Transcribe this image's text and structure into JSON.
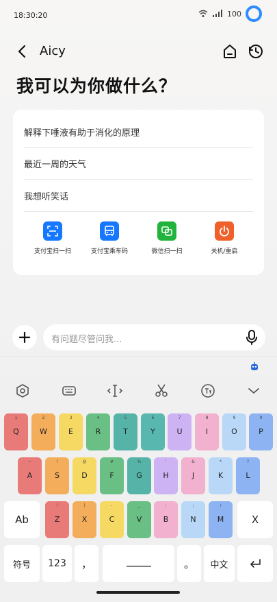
{
  "status": {
    "time": "18:30:20",
    "battery": "100"
  },
  "header": {
    "title": "Aicy"
  },
  "headline": "我可以为你做什么？",
  "suggestions": [
    "解释下唾液有助于消化的原理",
    "最近一周的天气",
    "我想听笑话"
  ],
  "shortcuts": [
    {
      "label": "支付宝扫一扫",
      "color": "#1677ff"
    },
    {
      "label": "支付宝乘车码",
      "color": "#1677ff"
    },
    {
      "label": "微信扫一扫",
      "color": "#21b33b"
    },
    {
      "label": "关机/重启",
      "color": "#f0602a"
    }
  ],
  "input": {
    "placeholder": "有问题尽管问我..."
  },
  "keyboard": {
    "row1": [
      {
        "k": "Q",
        "s": "1",
        "c": "#e87b78"
      },
      {
        "k": "W",
        "s": "2",
        "c": "#f4ae5b"
      },
      {
        "k": "E",
        "s": "3",
        "c": "#f6d963"
      },
      {
        "k": "R",
        "s": "4",
        "c": "#69bf84"
      },
      {
        "k": "T",
        "s": "5",
        "c": "#55b4a7"
      },
      {
        "k": "Y",
        "s": "6",
        "c": "#58b7ae"
      },
      {
        "k": "U",
        "s": "7",
        "c": "#cdb3f4"
      },
      {
        "k": "I",
        "s": "8",
        "c": "#f1b1cf"
      },
      {
        "k": "O",
        "s": "9",
        "c": "#b9d8f7"
      },
      {
        "k": "P",
        "s": "0",
        "c": "#8db3f3"
      }
    ],
    "row2": [
      {
        "k": "A",
        "s": "~",
        "c": "#e87b78"
      },
      {
        "k": "S",
        "s": "!",
        "c": "#f4ae5b"
      },
      {
        "k": "D",
        "s": "@",
        "c": "#f6d963"
      },
      {
        "k": "F",
        "s": "#",
        "c": "#69bf84"
      },
      {
        "k": "G",
        "s": "%",
        "c": "#55b4a7"
      },
      {
        "k": "H",
        "s": "'",
        "c": "#cdb3f4"
      },
      {
        "k": "J",
        "s": "&",
        "c": "#f1b1cf"
      },
      {
        "k": "K",
        "s": "*",
        "c": "#b9d8f7"
      },
      {
        "k": "L",
        "s": "?",
        "c": "#8db3f3"
      }
    ],
    "row3": [
      {
        "k": "Z",
        "s": "(",
        "c": "#e87b78"
      },
      {
        "k": "X",
        "s": ")",
        "c": "#f4ae5b"
      },
      {
        "k": "C",
        "s": "-",
        "c": "#f6d963"
      },
      {
        "k": "V",
        "s": "_",
        "c": "#69bf84"
      },
      {
        "k": "B",
        "s": ":",
        "c": "#f1b1cf"
      },
      {
        "k": "N",
        "s": ";",
        "c": "#b9d8f7"
      },
      {
        "k": "M",
        "s": "/",
        "c": "#8db3f3"
      }
    ],
    "shift": "Ab",
    "delete": "X",
    "symbols": "符号",
    "numbers": "123",
    "comma": "，",
    "period": "。",
    "lang": "中文"
  }
}
